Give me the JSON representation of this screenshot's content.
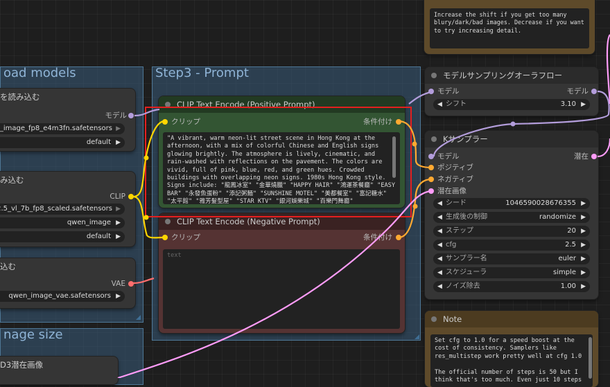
{
  "groups": {
    "load_models": {
      "title": "oad models"
    },
    "prompt": {
      "title": "Step3 - Prompt"
    },
    "image_size": {
      "title": "nage size"
    }
  },
  "load_diffusion": {
    "title": "を読み込む",
    "output_label": "モデル",
    "unet_name": "n_image_fp8_e4m3fn.safetensors",
    "weight_dtype": "default"
  },
  "load_clip": {
    "title": "み込む",
    "output_label": "CLIP",
    "clip_name": "2.5_vl_7b_fp8_scaled.safetensors",
    "type": "qwen_image",
    "device": "default"
  },
  "load_vae": {
    "title": "込む",
    "output_label": "VAE",
    "vae_name": "qwen_image_vae.safetensors"
  },
  "latent_node": {
    "title": "D3潜在画像"
  },
  "positive": {
    "title": "CLIP Text Encode (Positive Prompt)",
    "input_label": "クリップ",
    "output_label": "条件付け",
    "text": "\"A vibrant, warm neon-lit street scene in Hong Kong at the afternoon, with a mix of colorful Chinese and English signs glowing brightly. The atmosphere is lively, cinematic, and rain-washed with reflections on the pavement. The colors are vivid, full of pink, blue, red, and green hues. Crowded buildings with overlapping neon signs. 1980s Hong Kong style. Signs include: \"龍鳳冰室\" \"金華燒臘\" \"HAPPY HAIR\" \"鴻運茶餐廳\" \"EASY BAR\" \"永發魚蛋粉\" \"添記粥麵\" \"SUNSHINE MOTEL\" \"美都餐室\" \"富記糖水\" \"太平館\" \"雅芳髮型屋\" \"STAR KTV\" \"銀河娛樂城\" \"百樂門舞廳\""
  },
  "negative": {
    "title": "CLIP Text Encode (Negative Prompt)",
    "input_label": "クリップ",
    "output_label": "条件付け",
    "placeholder": "text"
  },
  "note_top": {
    "text": "Increase the shift if you get too many blury/dark/bad images. Decrease if you want to try increasing detail."
  },
  "sampling": {
    "title": "モデルサンプリングオーラフロー",
    "input_label": "モデル",
    "output_label": "モデル",
    "shift_label": "シフト",
    "shift_value": "3.10"
  },
  "ksampler": {
    "title": "Kサンプラー",
    "inputs": [
      "モデル",
      "ポジティブ",
      "ネガティブ",
      "潜在画像"
    ],
    "output_label": "潜在",
    "widgets": [
      {
        "label": "シード",
        "value": "1046590028676355"
      },
      {
        "label": "生成後の制御",
        "value": "randomize"
      },
      {
        "label": "ステップ",
        "value": "20"
      },
      {
        "label": "cfg",
        "value": "2.5"
      },
      {
        "label": "サンプラー名",
        "value": "euler"
      },
      {
        "label": "スケジューラ",
        "value": "simple"
      },
      {
        "label": "ノイズ除去",
        "value": "1.00"
      }
    ]
  },
  "note_bottom": {
    "title": "Note",
    "text": "Set cfg to 1.0 for a speed boost at the cost of consistency. Samplers like res_multistep work pretty well at cfg 1.0\n\nThe official number of steps is 50 but I think that's too much. Even just 10 steps"
  },
  "colors": {
    "model_wire": "#b39ddb",
    "clip_wire": "#ffd500",
    "vae_wire": "#ff6e6e",
    "cond_wire": "#ffa931",
    "latent_wire": "#ff9cf9",
    "selection": "#e41f1f"
  }
}
